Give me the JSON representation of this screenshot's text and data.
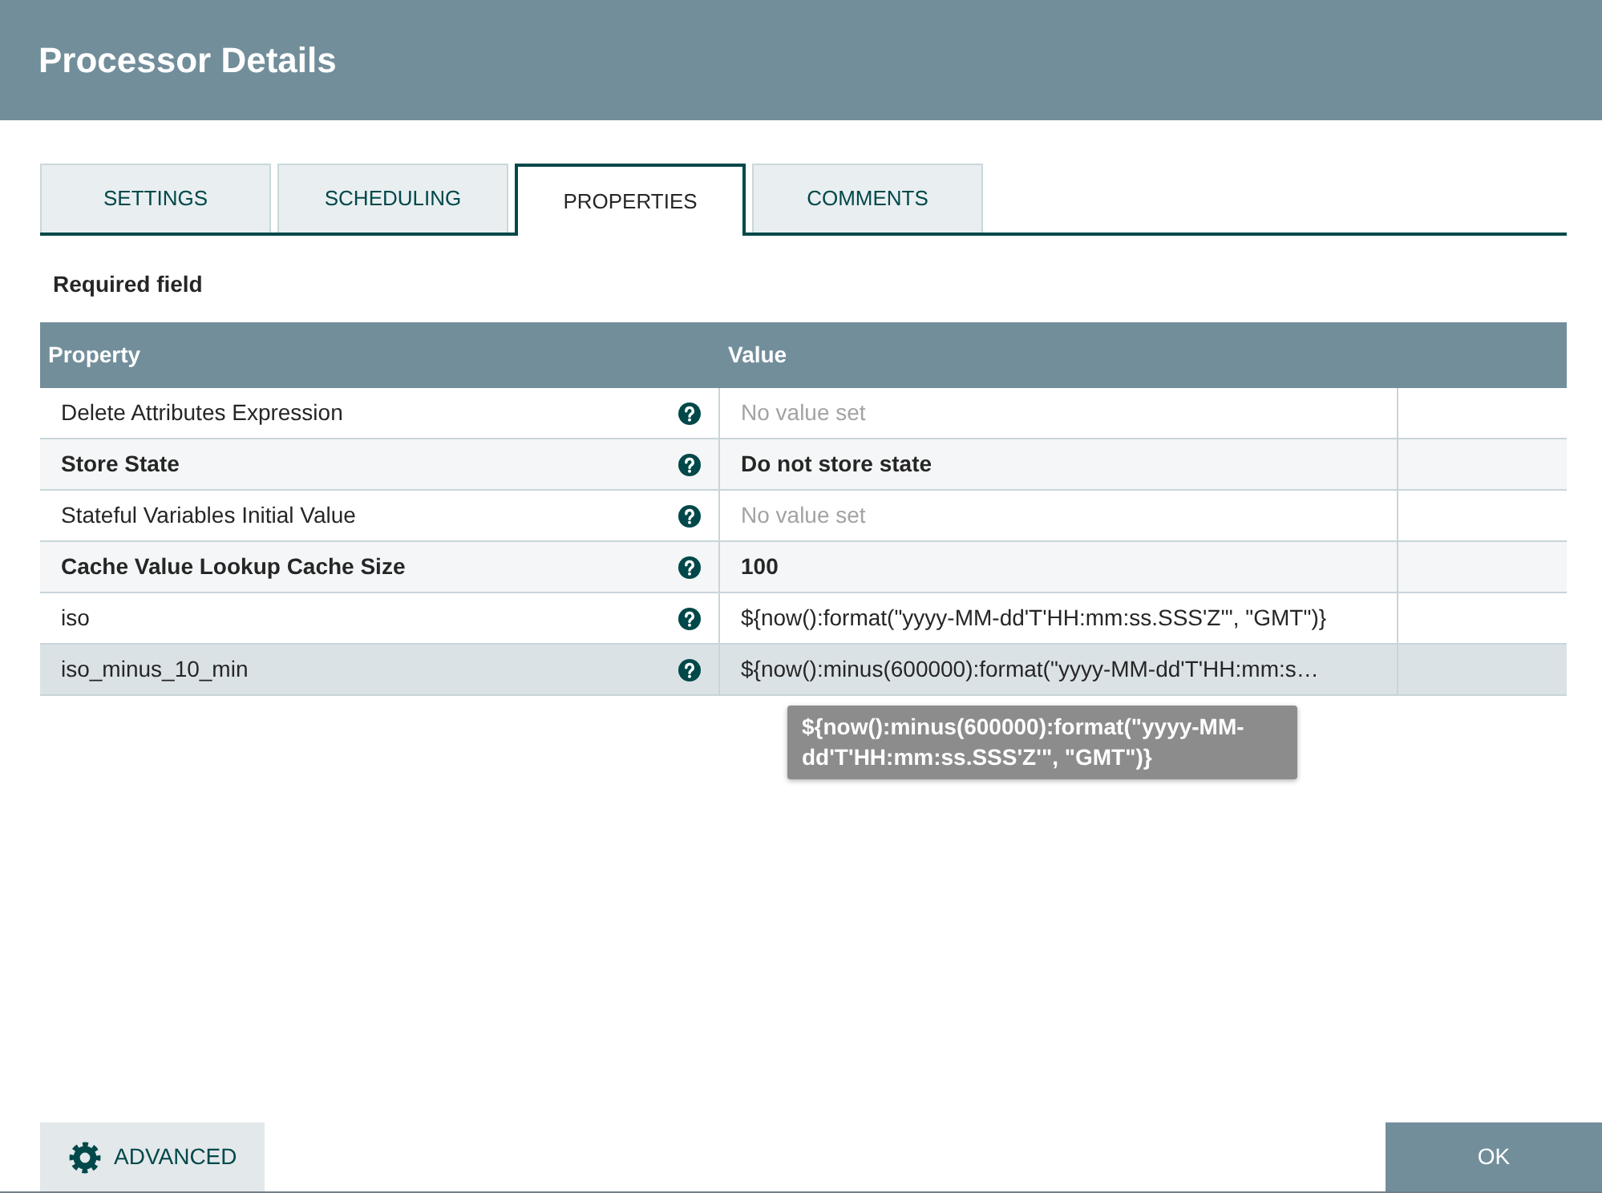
{
  "window": {
    "title": "Processor Details"
  },
  "tabs": [
    {
      "label": "SETTINGS",
      "selected": false
    },
    {
      "label": "SCHEDULING",
      "selected": false
    },
    {
      "label": "PROPERTIES",
      "selected": true
    },
    {
      "label": "COMMENTS",
      "selected": false
    }
  ],
  "required_note": "Required field",
  "table": {
    "columns": [
      "Property",
      "Value"
    ],
    "rows": [
      {
        "property": "Delete Attributes Expression",
        "required": false,
        "value": "No value set",
        "value_set": false,
        "selected": false
      },
      {
        "property": "Store State",
        "required": true,
        "value": "Do not store state",
        "value_set": true,
        "selected": false
      },
      {
        "property": "Stateful Variables Initial Value",
        "required": false,
        "value": "No value set",
        "value_set": false,
        "selected": false
      },
      {
        "property": "Cache Value Lookup Cache Size",
        "required": true,
        "value": "100",
        "value_set": true,
        "selected": false
      },
      {
        "property": "iso",
        "required": false,
        "value": "${now():format(\"yyyy-MM-dd'T'HH:mm:ss.SSS'Z'\", \"GMT\")}",
        "value_set": true,
        "selected": false
      },
      {
        "property": "iso_minus_10_min",
        "required": false,
        "value": "${now():minus(600000):format(\"yyyy-MM-dd'T'HH:mm:s…",
        "value_set": true,
        "selected": true
      }
    ]
  },
  "tooltip": {
    "text": "${now():minus(600000):format(\"yyyy-MM-dd'T'HH:mm:ss.SSS'Z'\", \"GMT\")}"
  },
  "buttons": [
    {
      "kind": "advanced",
      "label": "ADVANCED"
    },
    {
      "kind": "ok",
      "label": "OK"
    }
  ]
}
